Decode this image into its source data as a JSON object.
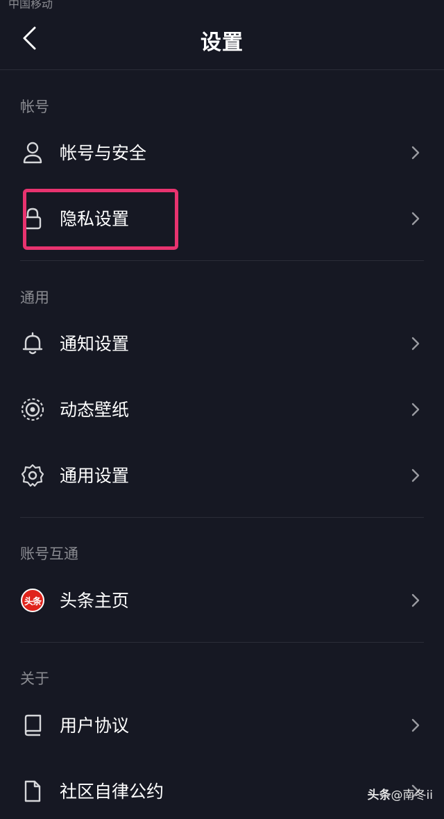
{
  "statusbar": {
    "carrier": "中国移动"
  },
  "header": {
    "title": "设置"
  },
  "sections": {
    "account": "帐号",
    "general": "通用",
    "linked": "账号互通",
    "about": "关于"
  },
  "items": {
    "account_security": "帐号与安全",
    "privacy": "隐私设置",
    "notifications": "通知设置",
    "wallpaper": "动态壁纸",
    "general_settings": "通用设置",
    "toutiao_home": "头条主页",
    "user_agreement": "用户协议",
    "community_rules": "社区自律公约"
  },
  "toutiao_logo_text": "头条",
  "watermark": {
    "brand": "头条",
    "handle": "@南冬ii"
  },
  "colors": {
    "background": "#161823",
    "highlight": "#e8336f",
    "muted": "#8a8b91",
    "toutiao_red": "#e0241c"
  }
}
